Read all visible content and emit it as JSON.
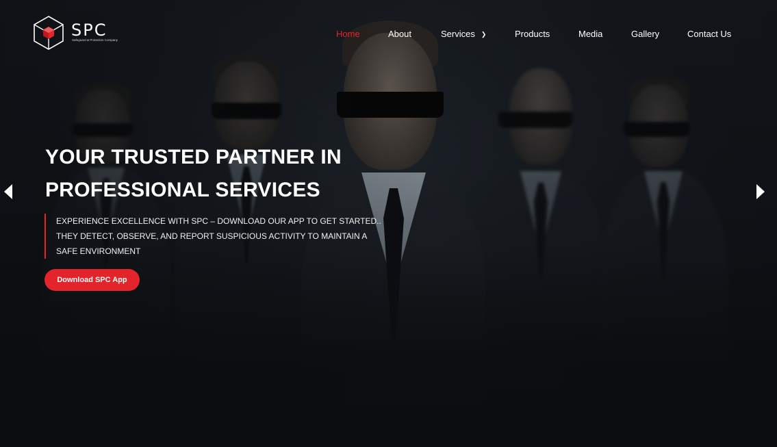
{
  "brand": {
    "name": "SPC",
    "tagline": "Safeguard & Protection Company",
    "accent_color": "#e3242b"
  },
  "nav": {
    "items": [
      {
        "label": "Home",
        "active": true
      },
      {
        "label": "About",
        "active": false
      },
      {
        "label": "Services",
        "active": false,
        "has_dropdown": true
      },
      {
        "label": "Products",
        "active": false
      },
      {
        "label": "Media",
        "active": false
      },
      {
        "label": "Gallery",
        "active": false
      },
      {
        "label": "Contact Us",
        "active": false
      }
    ],
    "dropdown_icon": "chevron-down-icon"
  },
  "hero": {
    "headline_line1": "YOUR TRUSTED PARTNER IN",
    "headline_line2": "PROFESSIONAL SERVICES",
    "description": "EXPERIENCE EXCELLENCE WITH SPC – DOWNLOAD OUR APP TO GET STARTED.. THEY DETECT, OBSERVE, AND REPORT SUSPICIOUS ACTIVITY TO MAINTAIN A SAFE ENVIRONMENT",
    "cta_label": "Download SPC App",
    "prev_icon": "arrow-left-icon",
    "next_icon": "arrow-right-icon"
  }
}
